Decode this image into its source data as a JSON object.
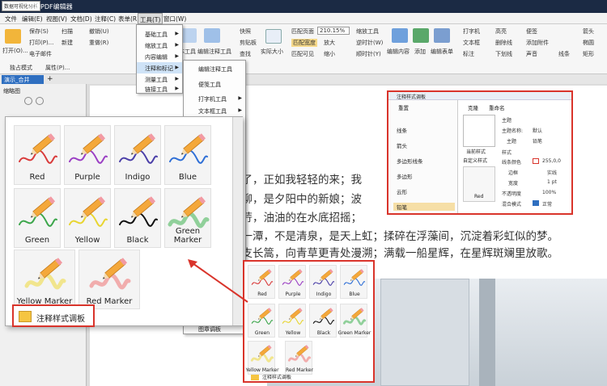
{
  "titlebar": {
    "tag": "数据可视化分析",
    "app_title": "迅捷PDF编辑器"
  },
  "menu": {
    "items": [
      "文件",
      "编辑(E)",
      "视图(V)",
      "文档(D)",
      "注释(C)",
      "表单(R)",
      "工具(T)",
      "窗口(W)"
    ],
    "active": "工具(T)"
  },
  "ribbon": {
    "open": "打开(O)...",
    "save": "保存(S)",
    "print": "打印(P)...",
    "email": "电子邮件",
    "scan": "扫描",
    "new": "新建",
    "undo": "撤销(U)",
    "redo": "重做(R)",
    "snapshot": "快照",
    "clipboard": "剪贴板",
    "find": "查找",
    "actual_size": "实际大小",
    "fit_page": "匹配页面",
    "fit_width": "匹配宽度",
    "fit_visible": "匹配可见",
    "zoom_value": "210.15%",
    "zoom_in": "放大",
    "zoom_out": "缩小",
    "zoom_tool": "缩放工具",
    "rotate_left": "逆时针(W)",
    "rotate_right": "顺时针(Y)",
    "edit_content": "编辑内容",
    "add": "添加",
    "edit_form": "编辑表单",
    "highlight_tool": "高亮",
    "strikeout": "删除线",
    "underline": "下划线",
    "typewriter": "打字机",
    "textbox": "文本框",
    "annotation": "标注",
    "sticky": "便签",
    "attach_file": "添加附件",
    "sound": "声音",
    "line": "线条",
    "arrow": "箭头",
    "ellipse": "椭圆",
    "rectangle": "矩形",
    "edit_text_tool": "编辑文本工具",
    "edit_annot_tool": "编辑注释工具",
    "exclusive": "独占模式",
    "properties": "属性(P)..."
  },
  "tabs": {
    "doc_tab": "演示_合并",
    "add_tab": "+"
  },
  "sidepanel": {
    "title": "缩略图"
  },
  "tools_menu": {
    "items": [
      "基础工具",
      "缩放工具",
      "内容编辑",
      "注释和标记",
      "测量工具",
      "链接工具"
    ],
    "highlighted": "注释和标记"
  },
  "submenu": {
    "items": [
      "编辑注释工具",
      "便笺工具",
      "打字机工具",
      "文本框工具"
    ],
    "footer": "图章调板"
  },
  "document": {
    "lines": [
      "走了，正如我轻轻的来；我",
      "金柳，是夕阳中的新娘；波",
      "青荇，油油的在水底招摇；",
      "的一潭，不是清泉，是天上虹；揉碎在浮藻间，沉淀着彩虹似的梦。",
      "一支长篙，向青草更青处漫溯；满载一船星辉，在星辉斑斓里放歌。"
    ]
  },
  "palette": {
    "items": [
      "Red",
      "Purple",
      "Indigo",
      "Blue",
      "Green",
      "Yellow",
      "Black",
      "Green Marker",
      "Yellow Marker",
      "Red Marker"
    ],
    "footer": "注释样式调板"
  },
  "small_palette": {
    "items": [
      "Red",
      "Purple",
      "Indigo",
      "Blue",
      "Green",
      "Yellow",
      "Black",
      "Green Marker",
      "Yellow Marker",
      "Red Marker"
    ],
    "footer": "注释样式调板"
  },
  "annot_panel": {
    "title": "注释样式调板",
    "reset": "重置",
    "clone": "克隆",
    "rename": "重命名",
    "tools": [
      "线条",
      "箭头",
      "多边形线条",
      "多边形",
      "云形",
      "铅笔"
    ],
    "current_style": "当前样式",
    "custom_style": "自定义样式",
    "style_name": "Red",
    "props": {
      "section_theme": "主题",
      "theme_name_label": "主题名称:",
      "theme_name": "默认",
      "theme_label": "主题",
      "theme_value": "铅笔",
      "section_style": "样式",
      "line_color_label": "线条颜色",
      "line_color": "255,0,0",
      "border_label": "边框",
      "border_value": "实线",
      "width_label": "宽度",
      "width_value": "1 pt",
      "opacity_label": "不透明度",
      "opacity_value": "100%",
      "blend_label": "混合模式",
      "blend_value": "正常"
    }
  },
  "colors": {
    "red": "#d93b3b",
    "purple": "#9b3fc4",
    "indigo": "#4b3fa8",
    "blue": "#2f6fd6",
    "green": "#3ca64b",
    "yellow": "#e8d531",
    "black": "#111111",
    "green_marker": "#7ec98a",
    "yellow_marker": "#f0e27a",
    "red_marker": "#f0a0a0",
    "highlight_frame": "#d9342b"
  }
}
